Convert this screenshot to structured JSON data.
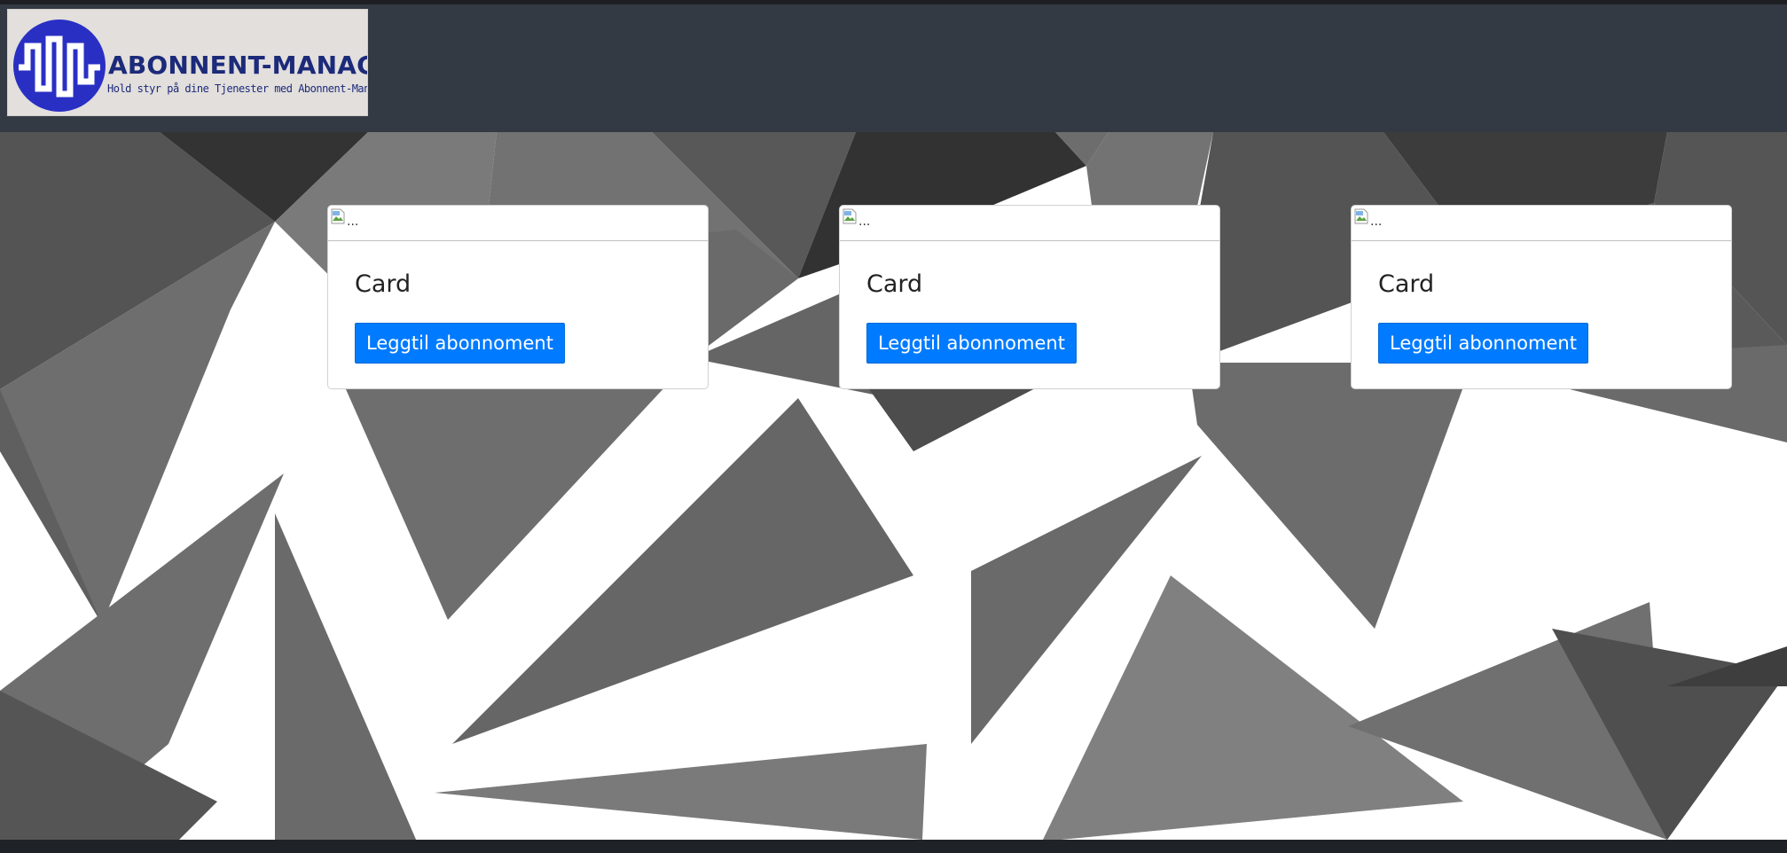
{
  "brand": {
    "name": "ABONNENT-MANAGER",
    "tagline": "Hold styr på dine Tjenester med Abonnent-Manager",
    "primary_color": "#1c2a7a",
    "logo_circle_color": "#2a2fc4"
  },
  "navbar": {
    "background": "#343a43"
  },
  "cards": [
    {
      "image_alt": "...",
      "title": "Card",
      "button_label": "Leggtil abonnoment"
    },
    {
      "image_alt": "...",
      "title": "Card",
      "button_label": "Leggtil abonnoment"
    },
    {
      "image_alt": "...",
      "title": "Card",
      "button_label": "Leggtil abonnoment"
    }
  ],
  "colors": {
    "button": "#007bff",
    "hero_background": "#ffffff"
  }
}
